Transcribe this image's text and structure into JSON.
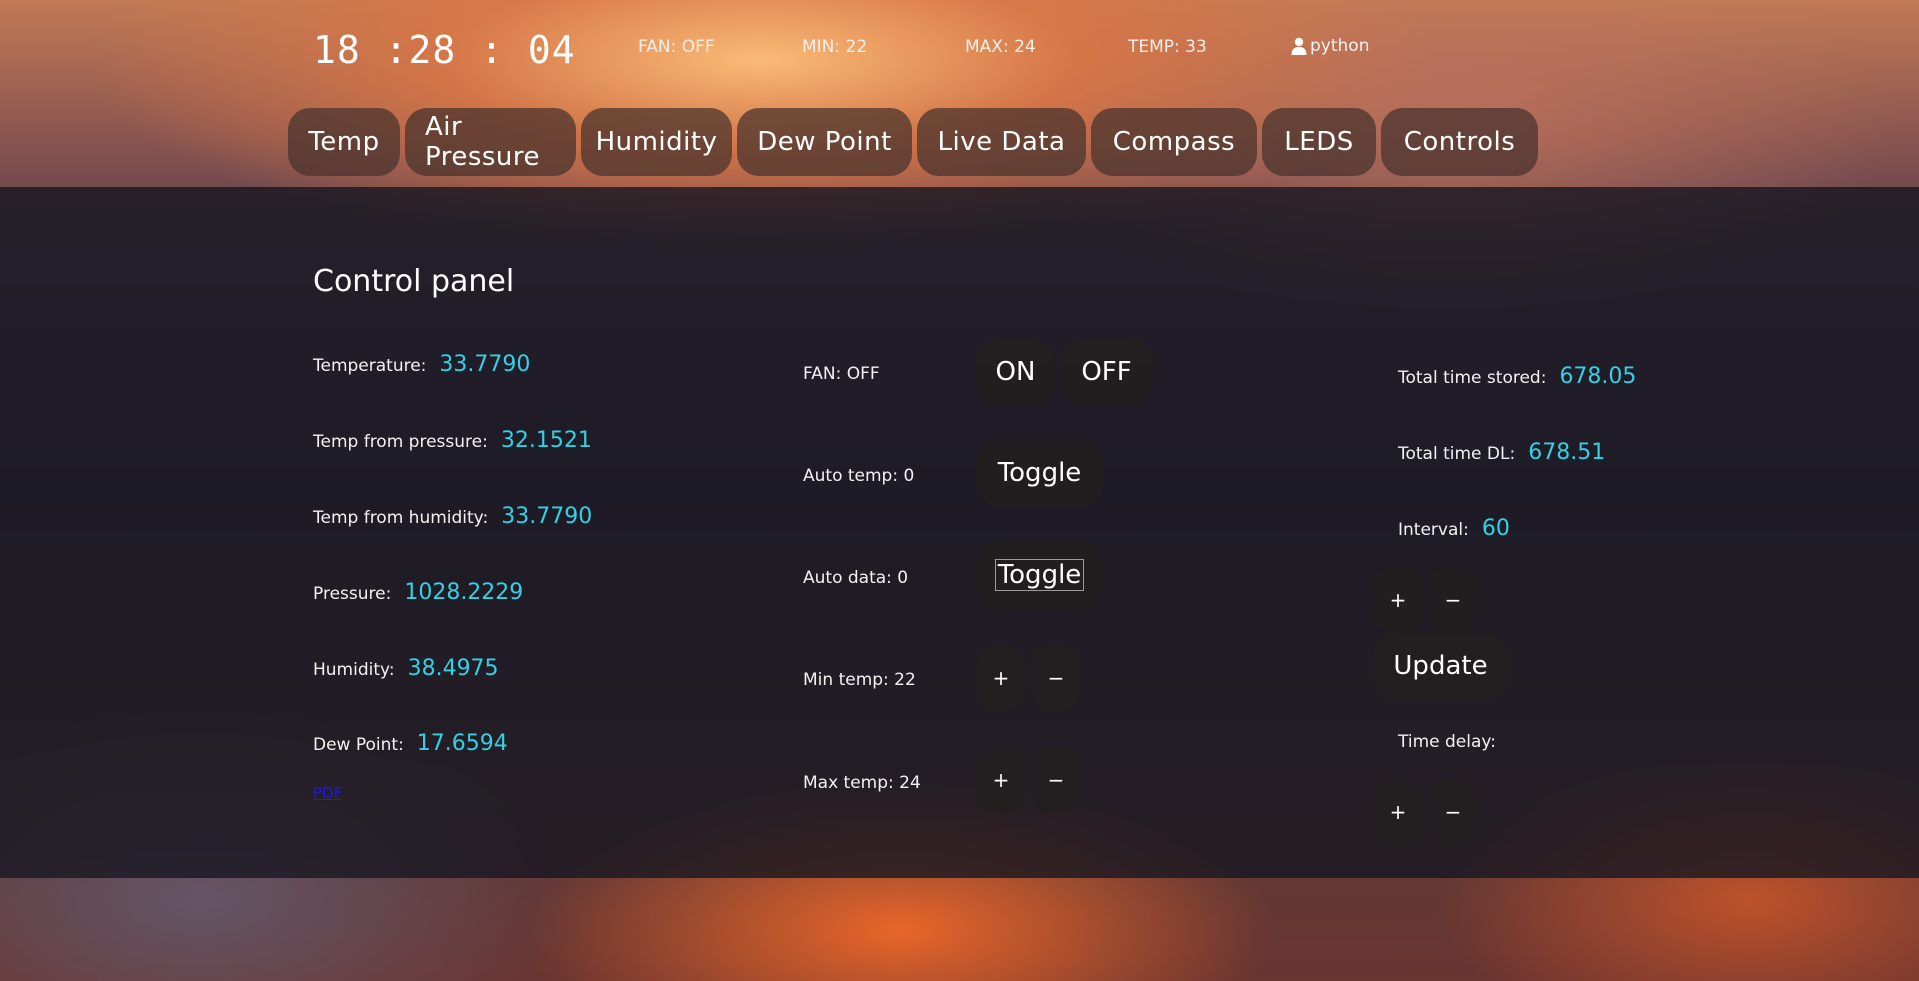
{
  "header": {
    "clock": "18 :28 : 04",
    "fan": "FAN: OFF",
    "min": "MIN: 22",
    "max": "MAX: 24",
    "temp": "TEMP: 33",
    "user": "python"
  },
  "nav": {
    "tabs": [
      "Temp",
      "Air Pressure",
      "Humidity",
      "Dew Point",
      "Live Data",
      "Compass",
      "LEDS",
      "Controls"
    ]
  },
  "panel": {
    "title": "Control panel",
    "readings": [
      {
        "label": "Temperature:",
        "value": "33.7790"
      },
      {
        "label": "Temp from pressure:",
        "value": "32.1521"
      },
      {
        "label": "Temp from humidity:",
        "value": "33.7790"
      },
      {
        "label": "Pressure:",
        "value": "1028.2229"
      },
      {
        "label": "Humidity:",
        "value": "38.4975"
      },
      {
        "label": "Dew Point:",
        "value": "17.6594"
      }
    ],
    "pdf_link": "PDF",
    "controls": {
      "fan_label": "FAN: OFF",
      "on_label": "ON",
      "off_label": "OFF",
      "auto_temp_label": "Auto temp: 0",
      "auto_data_label": "Auto data: 0",
      "toggle_label": "Toggle",
      "min_temp_label": "Min temp: 22",
      "max_temp_label": "Max temp: 24",
      "plus": "+",
      "minus": "−"
    },
    "timing": {
      "total_stored_label": "Total time stored:",
      "total_stored_value": "678.05",
      "total_dl_label": "Total time DL:",
      "total_dl_value": "678.51",
      "interval_label": "Interval:",
      "interval_value": "60",
      "update_label": "Update",
      "time_delay_label": "Time delay:"
    }
  },
  "colors": {
    "value": "#33d1e6",
    "link": "#1a1af0"
  },
  "icons": {
    "user": "user-icon"
  }
}
